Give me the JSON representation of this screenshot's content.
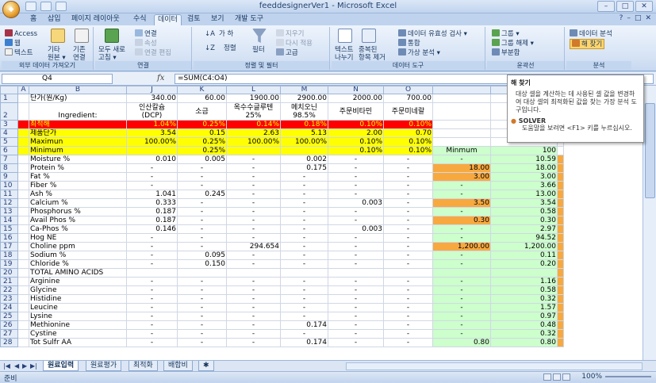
{
  "window": {
    "title": "feeddesignerVer1 - Microsoft Excel"
  },
  "ribbon_tabs": [
    "홈",
    "삽입",
    "페이지 레이아웃",
    "수식",
    "데이터",
    "검토",
    "보기",
    "개발 도구"
  ],
  "active_tab": "데이터",
  "ribbon": {
    "ext": {
      "access": "Access",
      "web": "웹",
      "text": "텍스트",
      "other": "기타",
      "other2": "원본 ▾",
      "existing": "기존",
      "existing2": "연결",
      "label": "외부 데이터 가져오기"
    },
    "conn": {
      "refresh": "모두 새로",
      "refresh2": "고침 ▾",
      "connect": "연결",
      "props": "속성",
      "edit": "연결 편집",
      "label": "연결"
    },
    "sort": {
      "sort": "정렬",
      "filter": "필터",
      "clear": "지우기",
      "reapply": "다시 적용",
      "advanced": "고급",
      "label": "정렬 및 필터"
    },
    "tools": {
      "t2c": "텍스트",
      "t2c2": "나누기",
      "dup": "중복된",
      "dup2": "항목 제거",
      "valid": "데이터 유효성 검사 ▾",
      "consol": "통합",
      "whatif": "가상 분석 ▾",
      "label": "데이터 도구"
    },
    "outline": {
      "group": "그룹 ▾",
      "ungroup": "그룹 해제 ▾",
      "subtotal": "부분합",
      "label": "윤곽선"
    },
    "analysis": {
      "analysis": "데이터 분석",
      "solver": "해 찾기",
      "label": "분석"
    }
  },
  "formula_bar": {
    "name": "Q4",
    "fx": "fx",
    "formula": "=SUM(C4:O4)"
  },
  "columns": [
    "",
    "A",
    "B",
    "J",
    "K",
    "L",
    "M",
    "N",
    "O",
    "",
    "",
    ""
  ],
  "rows": [
    {
      "n": "1",
      "b": "단가(원/Kg)",
      "j": "340.00",
      "k": "60.00",
      "l": "1900.00",
      "m": "2900.00",
      "n2": "2000.00",
      "o": "700.00"
    },
    {
      "n": "2",
      "b": "Ingredient:",
      "j": "인산칼슘 (DCP)",
      "k": "소금",
      "l": "옥수수글루텐 25%",
      "m": "메치오닌 98.5%",
      "n2": "주문비타민",
      "o": "주문미네랄"
    },
    {
      "n": "3",
      "b": "최적해",
      "j": "1.04%",
      "k": "0.25%",
      "l": "0.14%",
      "m": "0.18%",
      "n2": "0.10%",
      "o": "0.10%"
    },
    {
      "n": "4",
      "b": "제품단가",
      "j": "3.54",
      "k": "0.15",
      "l": "2.63",
      "m": "5.13",
      "n2": "2.00",
      "o": "0.70"
    },
    {
      "n": "5",
      "b": "Maximun",
      "j": "100.00%",
      "k": "0.25%",
      "l": "100.00%",
      "m": "100.00%",
      "n2": "0.10%",
      "o": "0.10%"
    },
    {
      "n": "6",
      "b": "Minimum",
      "j": "",
      "k": "0.25%",
      "l": "",
      "m": "",
      "n2": "0.10%",
      "o": "0.10%",
      "p": "Minmum",
      "q": "100"
    },
    {
      "n": "7",
      "b": "Moisture %",
      "j": "0.010",
      "k": "0.005",
      "l": "-",
      "m": "0.002",
      "n2": "-",
      "o": "-",
      "p": "-",
      "q": "10.59"
    },
    {
      "n": "8",
      "b": "Protein %",
      "j": "-",
      "k": "-",
      "l": "-",
      "m": "0.175",
      "n2": "-",
      "o": "-",
      "p": "18.00",
      "q": "18.00"
    },
    {
      "n": "9",
      "b": "Fat %",
      "j": "-",
      "k": "-",
      "l": "-",
      "m": "-",
      "n2": "-",
      "o": "-",
      "p": "3.00",
      "q": "3.00"
    },
    {
      "n": "10",
      "b": "Fiber %",
      "j": "-",
      "k": "-",
      "l": "-",
      "m": "-",
      "n2": "-",
      "o": "-",
      "p": "-",
      "q": "3.66"
    },
    {
      "n": "11",
      "b": "Ash %",
      "j": "1.041",
      "k": "0.245",
      "l": "-",
      "m": "-",
      "n2": "-",
      "o": "-",
      "p": "-",
      "q": "13.00"
    },
    {
      "n": "12",
      "b": "Calcium %",
      "j": "0.333",
      "k": "-",
      "l": "-",
      "m": "-",
      "n2": "0.003",
      "o": "-",
      "p": "3.50",
      "q": "3.54"
    },
    {
      "n": "13",
      "b": "Phosphorus %",
      "j": "0.187",
      "k": "-",
      "l": "-",
      "m": "-",
      "n2": "-",
      "o": "-",
      "p": "-",
      "q": "0.58"
    },
    {
      "n": "14",
      "b": "Avail Phos %",
      "j": "0.187",
      "k": "-",
      "l": "-",
      "m": "-",
      "n2": "-",
      "o": "-",
      "p": "0.30",
      "q": "0.30"
    },
    {
      "n": "15",
      "b": "Ca-Phos %",
      "j": "0.146",
      "k": "-",
      "l": "-",
      "m": "-",
      "n2": "0.003",
      "o": "-",
      "p": "-",
      "q": "2.97"
    },
    {
      "n": "16",
      "b": "Hog NE",
      "j": "-",
      "k": "-",
      "l": "-",
      "m": "-",
      "n2": "-",
      "o": "-",
      "p": "-",
      "q": "94.52"
    },
    {
      "n": "17",
      "b": "Choline ppm",
      "j": "-",
      "k": "-",
      "l": "294.654",
      "m": "-",
      "n2": "-",
      "o": "-",
      "p": "1,200.00",
      "q": "1,200.00"
    },
    {
      "n": "18",
      "b": "Sodium %",
      "j": "-",
      "k": "0.095",
      "l": "-",
      "m": "-",
      "n2": "-",
      "o": "-",
      "p": "-",
      "q": "0.11"
    },
    {
      "n": "19",
      "b": "Chloride %",
      "j": "-",
      "k": "0.150",
      "l": "-",
      "m": "-",
      "n2": "-",
      "o": "-",
      "p": "-",
      "q": "0.20"
    },
    {
      "n": "20",
      "b": "TOTAL AMINO ACIDS",
      "j": "",
      "k": "",
      "l": "",
      "m": "",
      "n2": "",
      "o": "",
      "p": "",
      "q": ""
    },
    {
      "n": "21",
      "b": "Arginine",
      "j": "-",
      "k": "-",
      "l": "-",
      "m": "-",
      "n2": "-",
      "o": "-",
      "p": "-",
      "q": "1.16"
    },
    {
      "n": "22",
      "b": "Glycine",
      "j": "-",
      "k": "-",
      "l": "-",
      "m": "-",
      "n2": "-",
      "o": "-",
      "p": "-",
      "q": "0.58"
    },
    {
      "n": "23",
      "b": "Histidine",
      "j": "-",
      "k": "-",
      "l": "-",
      "m": "-",
      "n2": "-",
      "o": "-",
      "p": "-",
      "q": "0.32"
    },
    {
      "n": "24",
      "b": "Leucine",
      "j": "-",
      "k": "-",
      "l": "-",
      "m": "-",
      "n2": "-",
      "o": "-",
      "p": "-",
      "q": "1.57"
    },
    {
      "n": "25",
      "b": "Lysine",
      "j": "-",
      "k": "-",
      "l": "-",
      "m": "-",
      "n2": "-",
      "o": "-",
      "p": "-",
      "q": "0.97"
    },
    {
      "n": "26",
      "b": "Methionine",
      "j": "-",
      "k": "-",
      "l": "-",
      "m": "0.174",
      "n2": "-",
      "o": "-",
      "p": "-",
      "q": "0.48"
    },
    {
      "n": "27",
      "b": "Cystine",
      "j": "-",
      "k": "-",
      "l": "-",
      "m": "-",
      "n2": "-",
      "o": "-",
      "p": "-",
      "q": "0.32"
    },
    {
      "n": "28",
      "b": "Tot Sulfr AA",
      "j": "-",
      "k": "-",
      "l": "-",
      "m": "0.174",
      "n2": "-",
      "o": "-",
      "p": "0.80",
      "q": "0.80"
    }
  ],
  "tooltip": {
    "title": "해 찾기",
    "body": "대상 셀을 계산하는 데 사용된 셀 값을 변경하여 대상 셀의 최적화된 값을 찾는 가장 분석 도구입니다.",
    "solver": "SOLVER",
    "sub": "도움말을 보려면 <F1> 키를 누르십시오."
  },
  "sheet_tabs": [
    "원료입력",
    "원료평가",
    "최적화",
    "배합비"
  ],
  "active_sheet": "원료입력",
  "status": {
    "mode": "준비",
    "zoom": "100%"
  }
}
